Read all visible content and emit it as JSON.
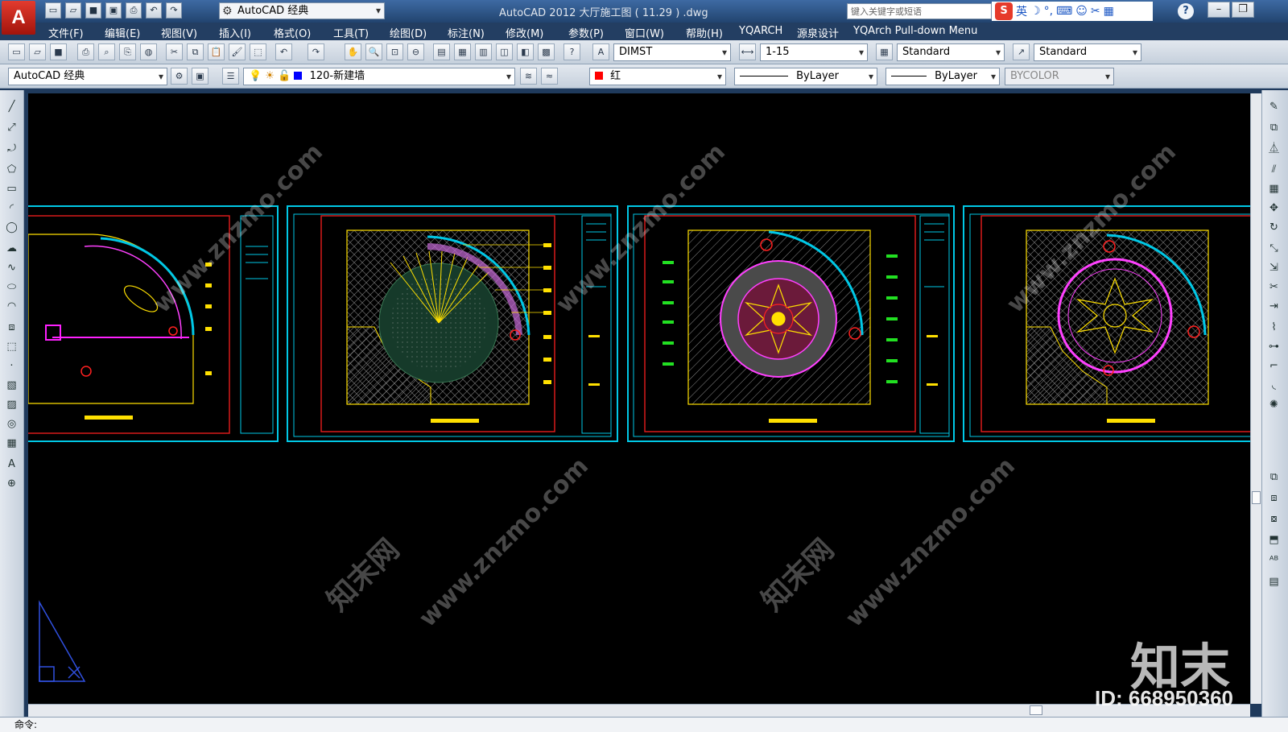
{
  "app": {
    "logo_letter": "A",
    "window_title": "AutoCAD 2012    大厅施工图 ( 11.29 ) .dwg",
    "workspace": "AutoCAD 经典",
    "search_placeholder": "键入关键字或短语",
    "ime_label": "英",
    "help": "?"
  },
  "menu": [
    "文件(F)",
    "编辑(E)",
    "视图(V)",
    "插入(I)",
    "格式(O)",
    "工具(T)",
    "绘图(D)",
    "标注(N)",
    "修改(M)",
    "参数(P)",
    "窗口(W)",
    "帮助(H)",
    "YQARCH",
    "源泉设计",
    "YQArch Pull-down Menu"
  ],
  "styles": {
    "text_style": "DIMST",
    "dim_style": "1-15",
    "table_style": "Standard",
    "mleader_style": "Standard"
  },
  "layers": {
    "workspace": "AutoCAD 经典",
    "current_layer": "120-新建墙",
    "layer_color": "#0000ff",
    "color": "红",
    "color_hex": "#ff0000",
    "linetype": "ByLayer",
    "lineweight": "ByLayer",
    "plotstyle": "BYCOLOR"
  },
  "command": {
    "prompt": "命令:"
  },
  "watermark": {
    "site": "www.znzmo.com",
    "brand": "知末",
    "id": "ID: 668950360",
    "cn": "知末网"
  },
  "colors": {
    "cad_cyan": "#00c8e6",
    "cad_yellow": "#ffff00",
    "cad_red": "#ff2020",
    "cad_magenta": "#ff00ff"
  }
}
